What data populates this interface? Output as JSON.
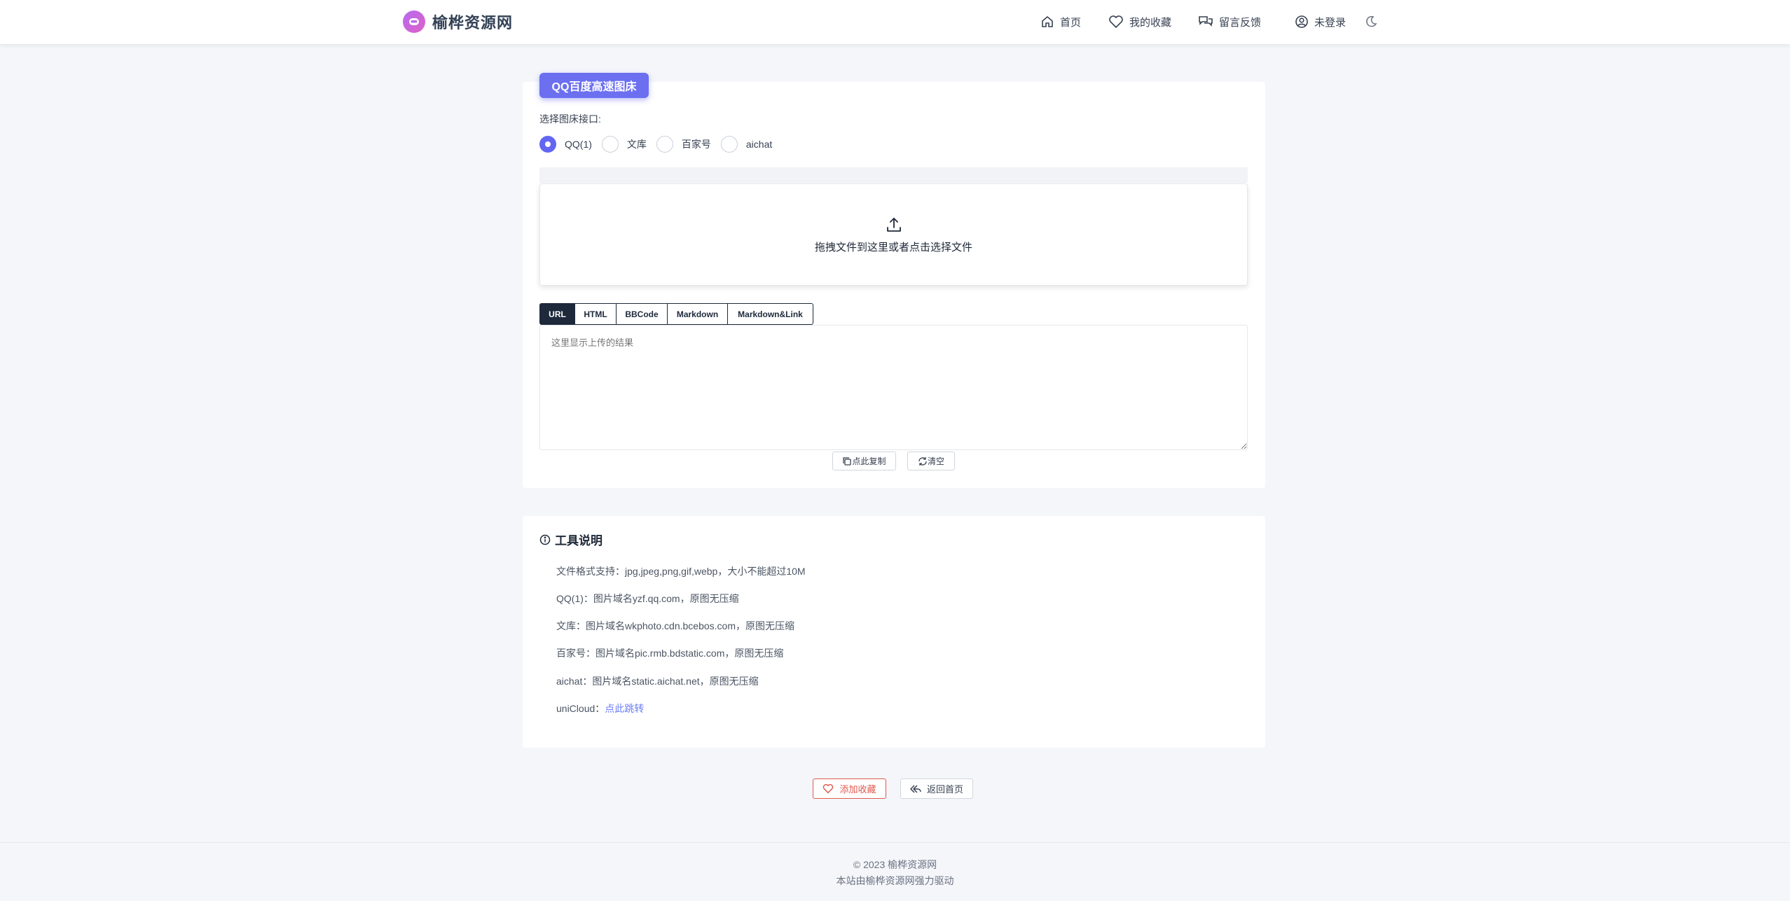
{
  "header": {
    "brand": "榆桦资源网",
    "nav": {
      "home": "首页",
      "favorites": "我的收藏",
      "feedback": "留言反馈",
      "login": "未登录"
    }
  },
  "uploader": {
    "tag": "QQ百度高速图床",
    "interface_label": "选择图床接口:",
    "interfaces": [
      {
        "label": "QQ(1)",
        "checked": true
      },
      {
        "label": "文库",
        "checked": false
      },
      {
        "label": "百家号",
        "checked": false
      },
      {
        "label": "aichat",
        "checked": false
      }
    ],
    "dropzone_text": "拖拽文件到这里或者点击选择文件",
    "format_tabs": [
      "URL",
      "HTML",
      "BBCode",
      "Markdown",
      "Markdown&Link"
    ],
    "active_tab": "URL",
    "result_placeholder": "这里显示上传的结果",
    "copy_label": "点此复制",
    "clear_label": "清空"
  },
  "tool_info": {
    "title": "工具说明",
    "lines": [
      "文件格式支持：jpg,jpeg,png,gif,webp，大小不能超过10M",
      "QQ(1)：图片域名yzf.qq.com，原图无压缩",
      "文库：图片域名wkphoto.cdn.bcebos.com，原图无压缩",
      "百家号：图片域名pic.rmb.bdstatic.com，原图无压缩",
      "aichat：图片域名static.aichat.net，原图无压缩"
    ],
    "unicloud_prefix": "uniCloud：",
    "unicloud_link": "点此跳转"
  },
  "actions": {
    "add_favorite": "添加收藏",
    "back_home": "返回首页"
  },
  "footer": {
    "copyright": "© 2023 榆桦资源网",
    "powered": "本站由榆桦资源网强力驱动"
  },
  "colors": {
    "accent": "#6366f1",
    "tag": "#6b6ff0",
    "dark": "#1e293b",
    "danger": "#e05a4f",
    "link": "#6b7cf3"
  }
}
